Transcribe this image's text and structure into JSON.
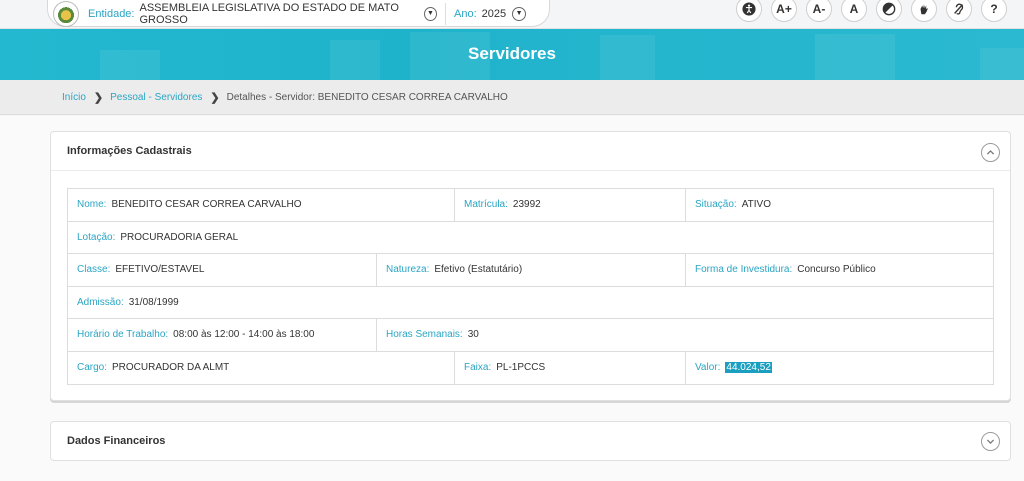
{
  "topbar": {
    "entidade_label": "Entidade:",
    "entidade_value": "ASSEMBLEIA LEGISLATIVA DO ESTADO DE MATO GROSSO",
    "ano_label": "Ano:",
    "ano_value": "2025",
    "accessibility": {
      "font_increase": "A+",
      "font_decrease": "A-",
      "font_normal": "A",
      "help": "?"
    }
  },
  "banner": {
    "title": "Servidores"
  },
  "breadcrumb": {
    "items": [
      "Início",
      "Pessoal - Servidores",
      "Detalhes - Servidor: BENEDITO CESAR CORREA CARVALHO"
    ]
  },
  "info_panel": {
    "title": "Informações Cadastrais",
    "fields": {
      "nome": {
        "label": "Nome:",
        "value": "BENEDITO CESAR CORREA CARVALHO"
      },
      "matricula": {
        "label": "Matrícula:",
        "value": "23992"
      },
      "situacao": {
        "label": "Situação:",
        "value": "ATIVO"
      },
      "lotacao": {
        "label": "Lotação:",
        "value": "PROCURADORIA GERAL"
      },
      "classe": {
        "label": "Classe:",
        "value": "EFETIVO/ESTAVEL"
      },
      "natureza": {
        "label": "Natureza:",
        "value": "Efetivo (Estatutário)"
      },
      "forma_investidura": {
        "label": "Forma de Investidura:",
        "value": "Concurso Público"
      },
      "admissao": {
        "label": "Admissão:",
        "value": "31/08/1999"
      },
      "horario": {
        "label": "Horário de Trabalho:",
        "value": "08:00 às 12:00 - 14:00 às 18:00"
      },
      "horas_semanais": {
        "label": "Horas Semanais:",
        "value": "30"
      },
      "cargo": {
        "label": "Cargo:",
        "value": "PROCURADOR DA ALMT"
      },
      "faixa": {
        "label": "Faixa:",
        "value": "PL-1PCCS"
      },
      "valor": {
        "label": "Valor:",
        "value": "44.024,52"
      }
    }
  },
  "financial_panel": {
    "title": "Dados Financeiros"
  },
  "colors": {
    "accent": "#2aa5c4",
    "banner": "#23b8cf",
    "highlight": "#1a9fc0"
  }
}
